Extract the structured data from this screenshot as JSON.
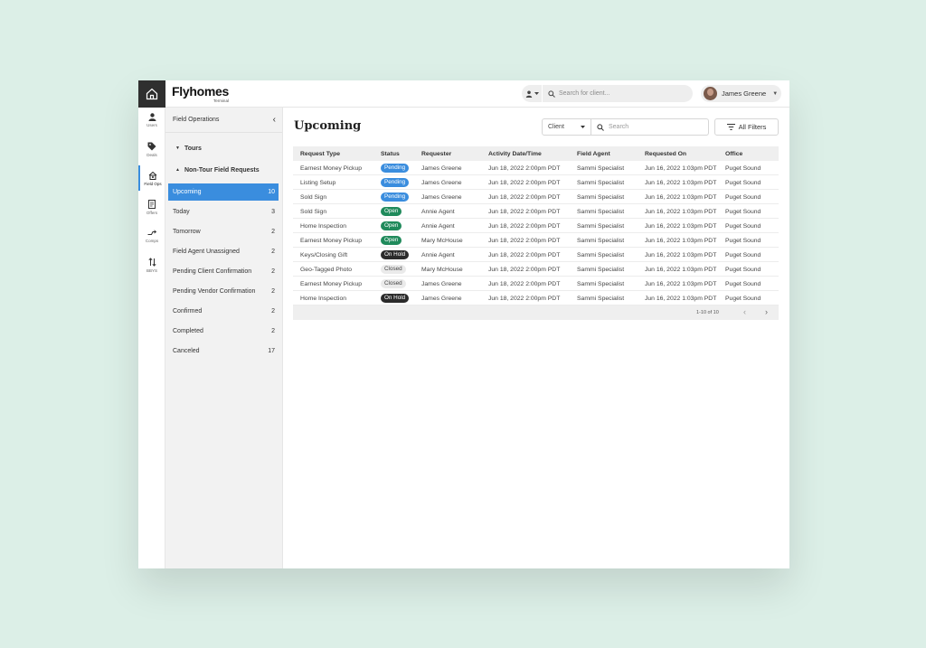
{
  "brand": {
    "name": "Flyhomes",
    "sub": "Terminal"
  },
  "top_search": {
    "placeholder": "Search for client..."
  },
  "user": {
    "name": "James Greene"
  },
  "iconbar": [
    {
      "label": "Users",
      "icon": "user-icon",
      "active": false
    },
    {
      "label": "Deals",
      "icon": "tag-icon",
      "active": false
    },
    {
      "label": "Field Ops",
      "icon": "field-ops-icon",
      "active": true
    },
    {
      "label": "Offers",
      "icon": "document-icon",
      "active": false
    },
    {
      "label": "Comps",
      "icon": "compare-icon",
      "active": false
    },
    {
      "label": "BBYS",
      "icon": "swap-icon",
      "active": false
    }
  ],
  "nav": {
    "title": "Field Operations",
    "groups": {
      "tours": "Tours",
      "non_tour": "Non-Tour Field Requests"
    },
    "items": [
      {
        "label": "Upcoming",
        "count": "10",
        "active": true
      },
      {
        "label": "Today",
        "count": "3"
      },
      {
        "label": "Tomorrow",
        "count": "2"
      },
      {
        "label": "Field Agent Unassigned",
        "count": "2"
      },
      {
        "label": "Pending Client Confirmation",
        "count": "2"
      },
      {
        "label": "Pending Vendor Confirmation",
        "count": "2"
      },
      {
        "label": "Confirmed",
        "count": "2"
      },
      {
        "label": "Completed",
        "count": "2"
      },
      {
        "label": "Canceled",
        "count": "17"
      }
    ]
  },
  "main": {
    "title": "Upcoming",
    "client_select": "Client",
    "search_placeholder": "Search",
    "filters_label": "All Filters",
    "columns": [
      "Request Type",
      "Status",
      "Requester",
      "Activity Date/Time",
      "Field Agent",
      "Requested On",
      "Office"
    ],
    "rows": [
      {
        "type": "Earnest Money Pickup",
        "status": "Pending",
        "requester": "James Greene",
        "activity": "Jun 18, 2022 2:00pm PDT",
        "agent": "Sammi Specialist",
        "requested": "Jun 16, 2022 1:03pm PDT",
        "office": "Puget Sound"
      },
      {
        "type": "Listing Setup",
        "status": "Pending",
        "requester": "James Greene",
        "activity": "Jun 18, 2022 2:00pm PDT",
        "agent": "Sammi Specialist",
        "requested": "Jun 16, 2022 1:03pm PDT",
        "office": "Puget Sound"
      },
      {
        "type": "Sold Sign",
        "status": "Pending",
        "requester": "James Greene",
        "activity": "Jun 18, 2022 2:00pm PDT",
        "agent": "Sammi Specialist",
        "requested": "Jun 16, 2022 1:03pm PDT",
        "office": "Puget Sound"
      },
      {
        "type": "Sold Sign",
        "status": "Open",
        "requester": "Annie Agent",
        "activity": "Jun 18, 2022 2:00pm PDT",
        "agent": "Sammi Specialist",
        "requested": "Jun 16, 2022 1:03pm PDT",
        "office": "Puget Sound"
      },
      {
        "type": "Home Inspection",
        "status": "Open",
        "requester": "Annie Agent",
        "activity": "Jun 18, 2022 2:00pm PDT",
        "agent": "Sammi Specialist",
        "requested": "Jun 16, 2022 1:03pm PDT",
        "office": "Puget Sound"
      },
      {
        "type": "Earnest Money Pickup",
        "status": "Open",
        "requester": "Mary McHouse",
        "activity": "Jun 18, 2022 2:00pm PDT",
        "agent": "Sammi Specialist",
        "requested": "Jun 16, 2022 1:03pm PDT",
        "office": "Puget Sound"
      },
      {
        "type": "Keys/Closing Gift",
        "status": "On Hold",
        "requester": "Annie Agent",
        "activity": "Jun 18, 2022 2:00pm PDT",
        "agent": "Sammi Specialist",
        "requested": "Jun 16, 2022 1:03pm PDT",
        "office": "Puget Sound"
      },
      {
        "type": "Geo-Tagged Photo",
        "status": "Closed",
        "requester": "Mary McHouse",
        "activity": "Jun 18, 2022 2:00pm PDT",
        "agent": "Sammi Specialist",
        "requested": "Jun 16, 2022 1:03pm PDT",
        "office": "Puget Sound"
      },
      {
        "type": "Earnest Money Pickup",
        "status": "Closed",
        "requester": "James Greene",
        "activity": "Jun 18, 2022 2:00pm PDT",
        "agent": "Sammi Specialist",
        "requested": "Jun 16, 2022 1:03pm PDT",
        "office": "Puget Sound"
      },
      {
        "type": "Home Inspection",
        "status": "On Hold",
        "requester": "James Greene",
        "activity": "Jun 18, 2022 2:00pm PDT",
        "agent": "Sammi Specialist",
        "requested": "Jun 16, 2022 1:03pm PDT",
        "office": "Puget Sound"
      }
    ],
    "pagination": "1-10 of 10"
  },
  "colors": {
    "accent": "#3a8dde",
    "open": "#1f8a5b",
    "hold": "#2b2b2b",
    "background": "#dcefe7"
  }
}
